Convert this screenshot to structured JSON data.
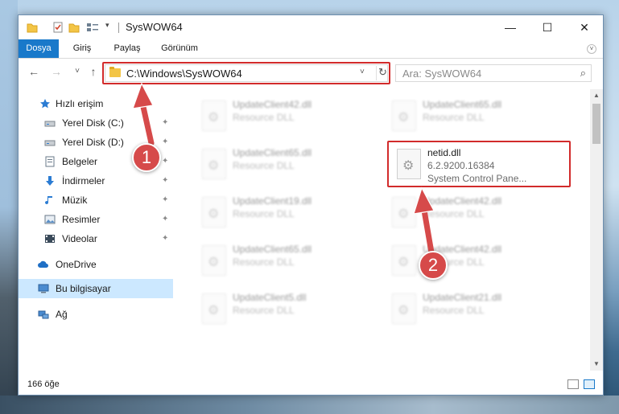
{
  "window": {
    "title": "SysWOW64",
    "minimize": "—",
    "maximize": "☐",
    "close": "✕"
  },
  "ribbon": {
    "tabs": [
      {
        "label": "Dosya",
        "active": true
      },
      {
        "label": "Giriş",
        "active": false
      },
      {
        "label": "Paylaş",
        "active": false
      },
      {
        "label": "Görünüm",
        "active": false
      }
    ],
    "expand": "˅"
  },
  "nav": {
    "back": "←",
    "forward": "→",
    "recent": "˅",
    "up": "↑",
    "address": "C:\\Windows\\SysWOW64",
    "address_dropdown": "˅",
    "refresh": "↻",
    "search_placeholder": "Ara: SysWOW64",
    "search_icon": "⌕"
  },
  "sidebar": {
    "items": [
      {
        "label": "Hızlı erişim",
        "icon": "star-icon",
        "pinned": false,
        "selected": false
      },
      {
        "label": "Yerel Disk (C:)",
        "icon": "drive-icon",
        "pinned": true,
        "selected": false
      },
      {
        "label": "Yerel Disk (D:)",
        "icon": "drive-icon",
        "pinned": true,
        "selected": false
      },
      {
        "label": "Belgeler",
        "icon": "documents-icon",
        "pinned": true,
        "selected": false
      },
      {
        "label": "İndirmeler",
        "icon": "download-icon",
        "pinned": true,
        "selected": false
      },
      {
        "label": "Müzik",
        "icon": "music-icon",
        "pinned": true,
        "selected": false
      },
      {
        "label": "Resimler",
        "icon": "pictures-icon",
        "pinned": true,
        "selected": false
      },
      {
        "label": "Videolar",
        "icon": "video-icon",
        "pinned": true,
        "selected": false
      },
      {
        "label": "OneDrive",
        "icon": "cloud-icon",
        "pinned": false,
        "selected": false
      },
      {
        "label": "Bu bilgisayar",
        "icon": "computer-icon",
        "pinned": false,
        "selected": true
      },
      {
        "label": "Ağ",
        "icon": "network-icon",
        "pinned": false,
        "selected": false
      }
    ],
    "pin_glyph": "📌"
  },
  "files": [
    {
      "name": "UpdateClient42.dll",
      "meta1": "Resource DLL",
      "meta2": "",
      "blurred": true
    },
    {
      "name": "UpdateClient65.dll",
      "meta1": "Resource DLL",
      "meta2": "",
      "blurred": true
    },
    {
      "name": "UpdateClient65.dll",
      "meta1": "Resource DLL",
      "meta2": "",
      "blurred": true
    },
    {
      "name": "netid.dll",
      "meta1": "6.2.9200.16384",
      "meta2": "System Control Pane...",
      "blurred": false
    },
    {
      "name": "UpdateClient19.dll",
      "meta1": "Resource DLL",
      "meta2": "",
      "blurred": true
    },
    {
      "name": "UpdateClient42.dll",
      "meta1": "Resource DLL",
      "meta2": "",
      "blurred": true
    },
    {
      "name": "UpdateClient65.dll",
      "meta1": "Resource DLL",
      "meta2": "",
      "blurred": true
    },
    {
      "name": "UpdateClient42.dll",
      "meta1": "Resource DLL",
      "meta2": "",
      "blurred": true
    },
    {
      "name": "UpdateClient5.dll",
      "meta1": "Resource DLL",
      "meta2": "",
      "blurred": true
    },
    {
      "name": "UpdateClient21.dll",
      "meta1": "Resource DLL",
      "meta2": "",
      "blurred": true
    }
  ],
  "scrollbar": {
    "up": "▲",
    "down": "▼"
  },
  "status": {
    "item_count": "166 öğe"
  },
  "callouts": [
    {
      "label": "1"
    },
    {
      "label": "2"
    }
  ],
  "colors": {
    "accent": "#1979ca",
    "highlight_red": "#d22b2b",
    "callout_red": "#d64a4a",
    "selected_bg": "#cce8ff"
  }
}
